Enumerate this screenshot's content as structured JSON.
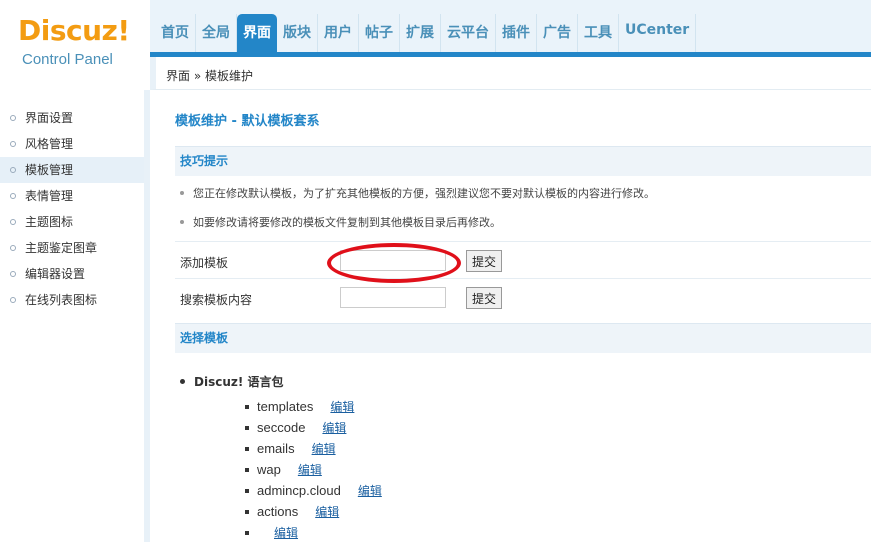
{
  "logo": {
    "main": "Discuz!",
    "sub": "Control Panel"
  },
  "nav": {
    "items": [
      "首页",
      "全局",
      "界面",
      "版块",
      "用户",
      "帖子",
      "扩展",
      "云平台",
      "插件",
      "广告",
      "工具",
      "UCenter"
    ],
    "active_index": 2
  },
  "breadcrumb": "界面 » 模板维护",
  "sidebar": {
    "items": [
      "界面设置",
      "风格管理",
      "模板管理",
      "表情管理",
      "主题图标",
      "主题鉴定图章",
      "编辑器设置",
      "在线列表图标"
    ],
    "active_index": 2
  },
  "main": {
    "title": "模板维护 - 默认模板套系",
    "tips_header": "技巧提示",
    "tips": [
      "您正在修改默认模板，为了扩充其他模板的方便，强烈建议您不要对默认模板的内容进行修改。",
      "如要修改请将要修改的模板文件复制到其他模板目录后再修改。"
    ],
    "add_template": {
      "label": "添加模板",
      "value": "",
      "button": "提交"
    },
    "search_template": {
      "label": "搜索模板内容",
      "value": "",
      "button": "提交"
    },
    "select_header": "选择模板",
    "tree": {
      "root": "Discuz! 语言包",
      "items": [
        {
          "name": "templates",
          "edit": "编辑"
        },
        {
          "name": "seccode",
          "edit": "编辑"
        },
        {
          "name": "emails",
          "edit": "编辑"
        },
        {
          "name": "wap",
          "edit": "编辑"
        },
        {
          "name": "admincp.cloud",
          "edit": "编辑"
        },
        {
          "name": "actions",
          "edit": "编辑"
        },
        {
          "name": "",
          "edit": "编辑"
        }
      ]
    }
  },
  "colors": {
    "accent": "#2386c8",
    "logo": "#f39c12",
    "annotation": "#e0101a"
  }
}
